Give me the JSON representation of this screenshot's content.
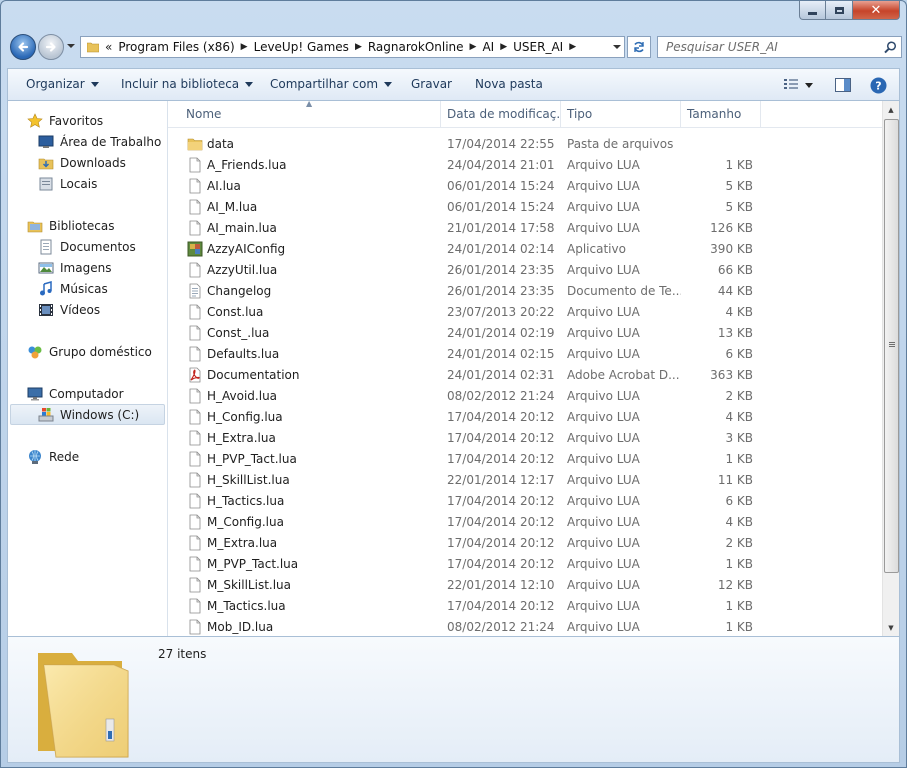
{
  "window": {
    "caption_buttons": [
      "minimize",
      "maximize",
      "close"
    ]
  },
  "address": {
    "overflow": "«",
    "crumbs": [
      "Program Files (x86)",
      "LeveUp! Games",
      "RagnarokOnline",
      "AI",
      "USER_AI"
    ],
    "search_placeholder": "Pesquisar USER_AI"
  },
  "toolbar": {
    "organize": "Organizar",
    "include_library": "Incluir na biblioteca",
    "share": "Compartilhar com",
    "burn": "Gravar",
    "new_folder": "Nova pasta"
  },
  "nav": {
    "favorites": "Favoritos",
    "desktop": "Área de Trabalho",
    "downloads": "Downloads",
    "places": "Locais",
    "libraries": "Bibliotecas",
    "documents": "Documentos",
    "images": "Imagens",
    "music": "Músicas",
    "videos": "Vídeos",
    "homegroup": "Grupo doméstico",
    "computer": "Computador",
    "drive_c": "Windows (C:)",
    "network": "Rede"
  },
  "columns": {
    "name": "Nome",
    "date": "Data de modificaç...",
    "type": "Tipo",
    "size": "Tamanho"
  },
  "files": [
    {
      "name": "data",
      "date": "17/04/2014 22:55",
      "type": "Pasta de arquivos",
      "size": "",
      "icon": "folder-icon"
    },
    {
      "name": "A_Friends.lua",
      "date": "24/04/2014 21:01",
      "type": "Arquivo LUA",
      "size": "1 KB",
      "icon": "document-icon"
    },
    {
      "name": "AI.lua",
      "date": "06/01/2014 15:24",
      "type": "Arquivo LUA",
      "size": "5 KB",
      "icon": "document-icon"
    },
    {
      "name": "AI_M.lua",
      "date": "06/01/2014 15:24",
      "type": "Arquivo LUA",
      "size": "5 KB",
      "icon": "document-icon"
    },
    {
      "name": "AI_main.lua",
      "date": "21/01/2014 17:58",
      "type": "Arquivo LUA",
      "size": "126 KB",
      "icon": "document-icon"
    },
    {
      "name": "AzzyAIConfig",
      "date": "24/01/2014 02:14",
      "type": "Aplicativo",
      "size": "390 KB",
      "icon": "application-icon"
    },
    {
      "name": "AzzyUtil.lua",
      "date": "26/01/2014 23:35",
      "type": "Arquivo LUA",
      "size": "66 KB",
      "icon": "document-icon"
    },
    {
      "name": "Changelog",
      "date": "26/01/2014 23:35",
      "type": "Documento de Te...",
      "size": "44 KB",
      "icon": "text-document-icon"
    },
    {
      "name": "Const.lua",
      "date": "23/07/2013 20:22",
      "type": "Arquivo LUA",
      "size": "4 KB",
      "icon": "document-icon"
    },
    {
      "name": "Const_.lua",
      "date": "24/01/2014 02:19",
      "type": "Arquivo LUA",
      "size": "13 KB",
      "icon": "document-icon"
    },
    {
      "name": "Defaults.lua",
      "date": "24/01/2014 02:15",
      "type": "Arquivo LUA",
      "size": "6 KB",
      "icon": "document-icon"
    },
    {
      "name": "Documentation",
      "date": "24/01/2014 02:31",
      "type": "Adobe Acrobat D...",
      "size": "363 KB",
      "icon": "pdf-icon"
    },
    {
      "name": "H_Avoid.lua",
      "date": "08/02/2012 21:24",
      "type": "Arquivo LUA",
      "size": "2 KB",
      "icon": "document-icon"
    },
    {
      "name": "H_Config.lua",
      "date": "17/04/2014 20:12",
      "type": "Arquivo LUA",
      "size": "4 KB",
      "icon": "document-icon"
    },
    {
      "name": "H_Extra.lua",
      "date": "17/04/2014 20:12",
      "type": "Arquivo LUA",
      "size": "3 KB",
      "icon": "document-icon"
    },
    {
      "name": "H_PVP_Tact.lua",
      "date": "17/04/2014 20:12",
      "type": "Arquivo LUA",
      "size": "1 KB",
      "icon": "document-icon"
    },
    {
      "name": "H_SkillList.lua",
      "date": "22/01/2014 12:17",
      "type": "Arquivo LUA",
      "size": "11 KB",
      "icon": "document-icon"
    },
    {
      "name": "H_Tactics.lua",
      "date": "17/04/2014 20:12",
      "type": "Arquivo LUA",
      "size": "6 KB",
      "icon": "document-icon"
    },
    {
      "name": "M_Config.lua",
      "date": "17/04/2014 20:12",
      "type": "Arquivo LUA",
      "size": "4 KB",
      "icon": "document-icon"
    },
    {
      "name": "M_Extra.lua",
      "date": "17/04/2014 20:12",
      "type": "Arquivo LUA",
      "size": "2 KB",
      "icon": "document-icon"
    },
    {
      "name": "M_PVP_Tact.lua",
      "date": "17/04/2014 20:12",
      "type": "Arquivo LUA",
      "size": "1 KB",
      "icon": "document-icon"
    },
    {
      "name": "M_SkillList.lua",
      "date": "22/01/2014 12:10",
      "type": "Arquivo LUA",
      "size": "12 KB",
      "icon": "document-icon"
    },
    {
      "name": "M_Tactics.lua",
      "date": "17/04/2014 20:12",
      "type": "Arquivo LUA",
      "size": "1 KB",
      "icon": "document-icon"
    },
    {
      "name": "Mob_ID.lua",
      "date": "08/02/2012 21:24",
      "type": "Arquivo LUA",
      "size": "1 KB",
      "icon": "document-icon"
    }
  ],
  "details": {
    "item_count": "27 itens"
  },
  "colors": {
    "frame": "#c9dcf0",
    "toolbar_text": "#1e395b",
    "muted_text": "#6d6d6d",
    "folder": "#e8c25a"
  }
}
